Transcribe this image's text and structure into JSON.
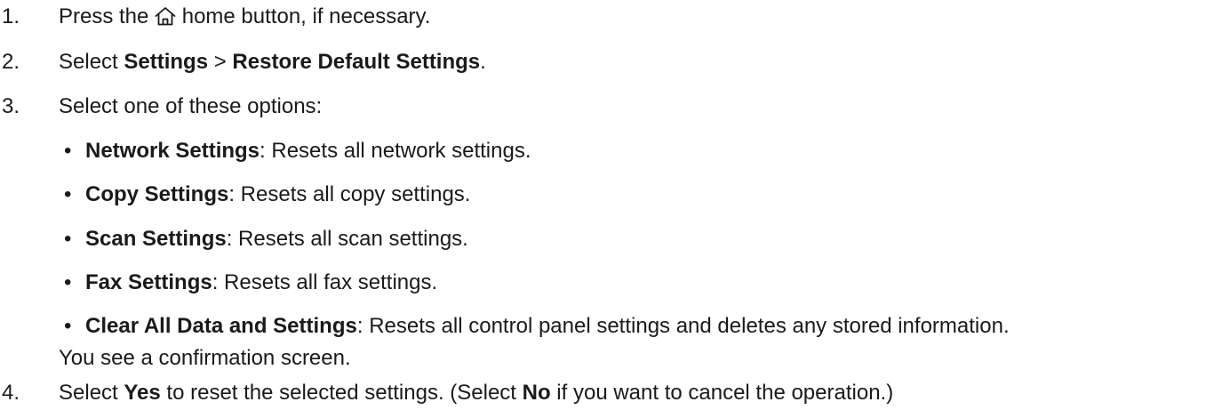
{
  "steps": [
    {
      "number": "1.",
      "pre": "Press the",
      "icon": "home-icon",
      "post": " home button, if necessary."
    },
    {
      "number": "2.",
      "pre": "Select ",
      "bold1": "Settings",
      "mid": " > ",
      "bold2": "Restore Default Settings",
      "post": "."
    },
    {
      "number": "3.",
      "text": "Select one of these options:",
      "options": [
        {
          "bullet": "•",
          "name": "Network Settings",
          "desc": ": Resets all network settings."
        },
        {
          "bullet": "•",
          "name": "Copy Settings",
          "desc": ": Resets all copy settings."
        },
        {
          "bullet": "•",
          "name": "Scan Settings",
          "desc": ": Resets all scan settings."
        },
        {
          "bullet": "•",
          "name": "Fax Settings",
          "desc": ": Resets all fax settings."
        },
        {
          "bullet": "•",
          "name": "Clear All Data and Settings",
          "desc": ": Resets all control panel settings and deletes any stored information."
        }
      ],
      "followup": "You see a confirmation screen."
    },
    {
      "number": "4.",
      "pre": "Select ",
      "bold1": "Yes",
      "mid": " to reset the selected settings. (Select ",
      "bold2": "No",
      "post": " if you want to cancel the operation.)"
    }
  ]
}
